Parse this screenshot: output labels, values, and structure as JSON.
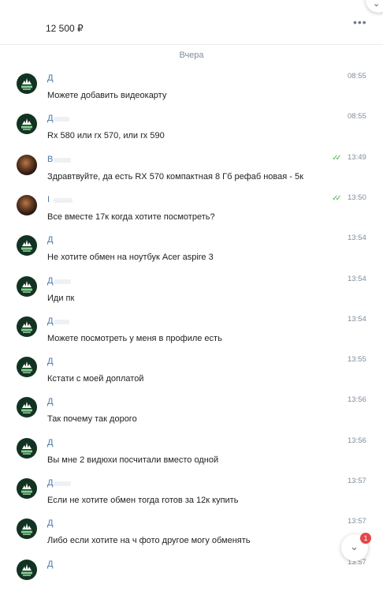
{
  "header": {
    "price": "12 500 ₽",
    "more_icon": "more-dots-icon",
    "corner_icon": "chevron-icon"
  },
  "date_separator": "Вчера",
  "messages": [
    {
      "author": "Д",
      "avatar": "adidas-logo",
      "time": "08:55",
      "read": false,
      "text": "Можете добавить видеокарту"
    },
    {
      "author": "Д",
      "avatar": "adidas-logo",
      "time": "08:55",
      "read": false,
      "text": "Rx 580 или rx 570, или rx 590"
    },
    {
      "author": "В",
      "avatar": "user-photo",
      "time": "13:49",
      "read": true,
      "text": "Здравтвуйте, да есть RX 570 компактная 8 Гб рефаб новая - 5к"
    },
    {
      "author": "I",
      "avatar": "user-photo",
      "time": "13:50",
      "read": true,
      "text": "Все вместе 17к когда хотите посмотреть?"
    },
    {
      "author": "Д",
      "avatar": "adidas-logo",
      "time": "13:54",
      "read": false,
      "text": "Не хотите обмен на ноутбук Acer aspire 3"
    },
    {
      "author": "Д",
      "avatar": "adidas-logo",
      "time": "13:54",
      "read": false,
      "text": "Иди пк"
    },
    {
      "author": "Д",
      "avatar": "adidas-logo",
      "time": "13:54",
      "read": false,
      "text": "Можете посмотреть у меня в профиле есть"
    },
    {
      "author": "Д",
      "avatar": "adidas-logo",
      "time": "13:55",
      "read": false,
      "text": "Кстати с моей доплатой"
    },
    {
      "author": "Д",
      "avatar": "adidas-logo",
      "time": "13:56",
      "read": false,
      "text": "Так почему так дорого"
    },
    {
      "author": "Д",
      "avatar": "adidas-logo",
      "time": "13:56",
      "read": false,
      "text": "Вы мне 2 видюхи посчитали вместо одной"
    },
    {
      "author": "Д",
      "avatar": "adidas-logo",
      "time": "13:57",
      "read": false,
      "text": "Если не хотите обмен тогда готов за 12к купить"
    },
    {
      "author": "Д",
      "avatar": "adidas-logo",
      "time": "13:57",
      "read": false,
      "text": "Либо если хотите на ч фото другое могу обменять"
    },
    {
      "author": "Д",
      "avatar": "adidas-logo",
      "time": "13:57",
      "read": false,
      "text": ""
    }
  ],
  "scroll_down": {
    "icon": "chevron-down-icon",
    "badge": "1"
  },
  "colors": {
    "author": "#4a76a8",
    "read_check": "#4bb34b",
    "badge": "#e64646",
    "avatar_bg": "#123322"
  }
}
